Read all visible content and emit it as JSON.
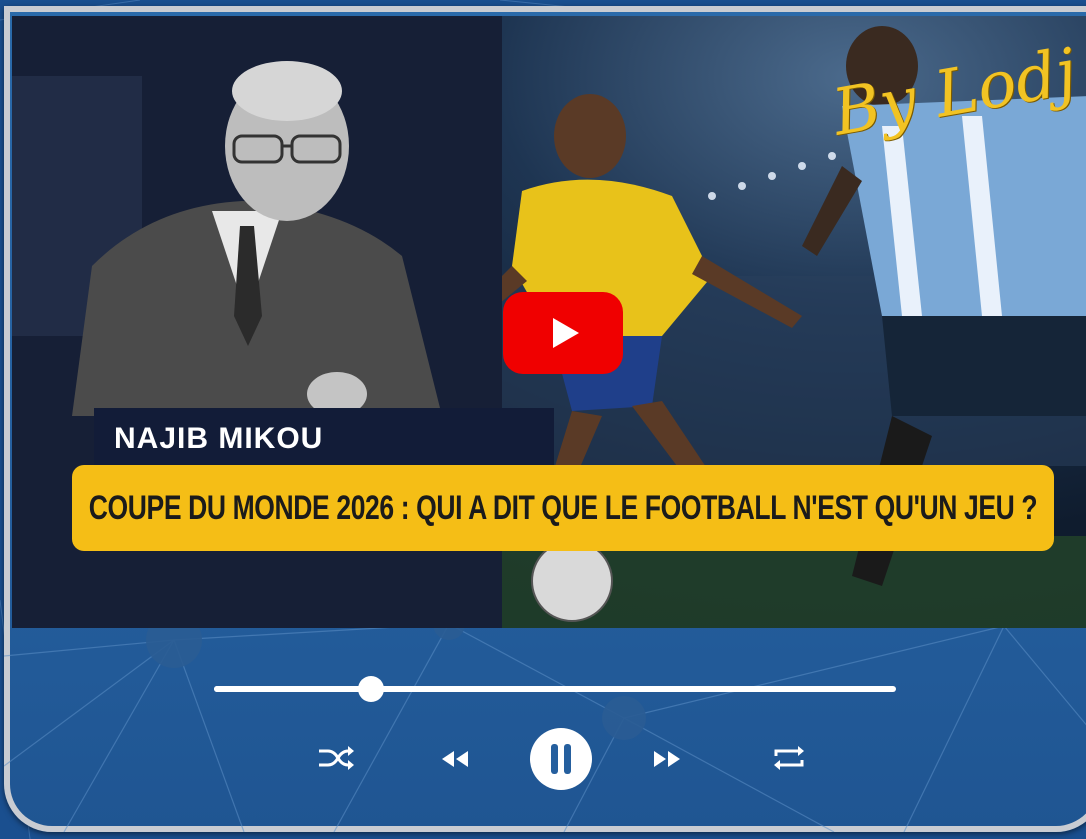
{
  "video": {
    "presenter_name": "NAJIB MIKOU",
    "headline": "COUPE DU MONDE 2026 : QUI A DIT QUE LE FOOTBALL N'EST QU'UN JEU ?",
    "signature": "By Lodj",
    "play_icon": "youtube-play-icon"
  },
  "player": {
    "progress_fraction": 0.23,
    "controls": [
      "shuffle-icon",
      "previous-icon",
      "pause-icon",
      "next-icon",
      "repeat-icon"
    ],
    "colors": {
      "accent": "#ffffff",
      "background": "#255f9e",
      "banner": "#f5be16",
      "play_red": "#f00000"
    }
  }
}
